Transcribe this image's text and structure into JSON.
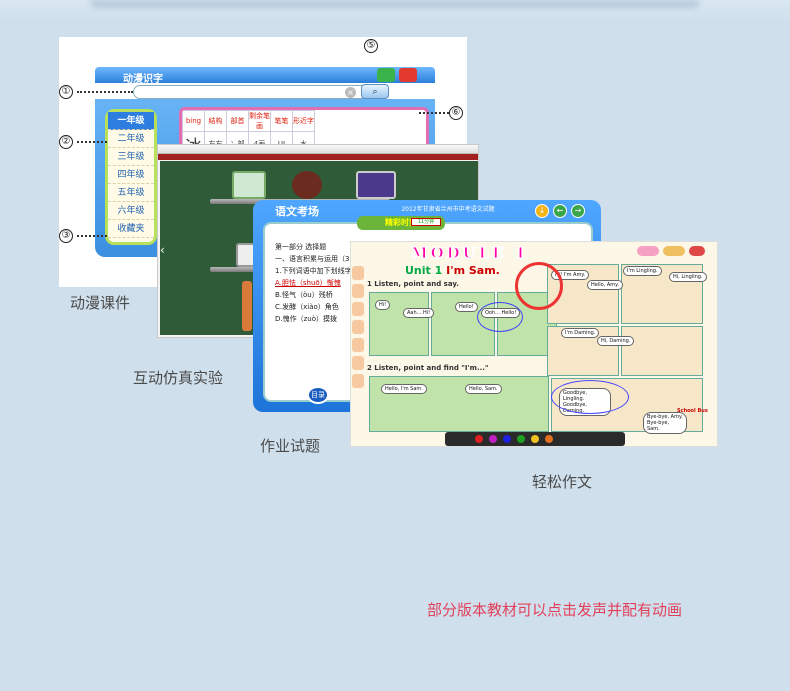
{
  "screen1": {
    "title": "动漫识字",
    "grades": [
      "一年级",
      "二年级",
      "三年级",
      "四年级",
      "五年级",
      "六年级",
      "收藏夹"
    ],
    "selected_grade": "一年级",
    "headers": [
      "bing",
      "结构",
      "部首",
      "剩余笔画",
      "笔笔",
      "形近字"
    ],
    "values": [
      "冰",
      "左右",
      "冫部",
      "4画",
      "UI",
      "水"
    ],
    "callouts": [
      "①",
      "②",
      "③",
      "⑤",
      "⑥"
    ]
  },
  "screen3": {
    "title": "语文考场",
    "header": "2012年甘肃省兰州市中考语文试题",
    "banner": "精彩时刻",
    "timer": "11分钟",
    "lines": [
      "第一部分 选择题",
      "一、语言积累与运用（30分",
      "1.下列词语中加下划线字注",
      "A.胆怯（shuō）惭愧",
      "C.发酵（xiào）角色",
      "B.怪气（òu）残桥",
      "D.愧作（zuò）摸拨"
    ],
    "menu_button": "目录"
  },
  "screen4": {
    "module": "MODULE 1",
    "unit": "Unit 1",
    "unit_title": "I'm Sam.",
    "section1": "1 Listen, point and say.",
    "section2": "2 Listen, point and find \"I'm...\"",
    "bubbles": [
      "Hi! I'm Amy.",
      "Hello, Amy.",
      "Hi, Lingling.",
      "I'm Lingling.",
      "Ooh... Hello!",
      "Hello!",
      "Aah... Hi!",
      "Hi!",
      "I'm Daming.",
      "Hi, Daming.",
      "Hello, I'm Sam.",
      "Hello, Sam.",
      "Goodbye, Lingling. Goodbye, Daming.",
      "Bye-bye, Amy. Bye-bye, Sam."
    ],
    "bus_text": "School Bus"
  },
  "captions": {
    "c1": "动漫课件",
    "c2": "互动仿真实验",
    "c3": "作业试题",
    "c4": "轻松作文"
  },
  "footnote": "部分版本教材可以点击发声并配有动画"
}
